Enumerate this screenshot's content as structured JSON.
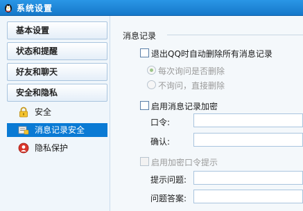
{
  "window": {
    "title": "系统设置"
  },
  "sidebar": {
    "categories": [
      {
        "label": "基本设置"
      },
      {
        "label": "状态和提醒"
      },
      {
        "label": "好友和聊天"
      },
      {
        "label": "安全和隐私"
      }
    ],
    "subitems": [
      {
        "label": "安全",
        "icon": "lock-icon",
        "selected": false
      },
      {
        "label": "消息记录安全",
        "icon": "message-record-icon",
        "selected": true
      },
      {
        "label": "隐私保护",
        "icon": "privacy-icon",
        "selected": false
      }
    ]
  },
  "content": {
    "section_title": "消息记录",
    "exit_delete": {
      "label": "退出QQ时自动删除所有消息记录",
      "checked": false
    },
    "radio_ask": {
      "label": "每次询问是否删除",
      "selected": true
    },
    "radio_no_ask": {
      "label": "不询问，直接删除",
      "selected": false
    },
    "encrypt": {
      "label": "启用消息记录加密",
      "checked": false
    },
    "password_label": "口令:",
    "confirm_label": "确认:",
    "password_hint": {
      "label": "启用加密口令提示",
      "checked": false
    },
    "hint_question_label": "提示问题:",
    "hint_answer_label": "问题答案:"
  },
  "colors": {
    "titlebar": "#1578c9",
    "selected": "#0a7ad4"
  }
}
